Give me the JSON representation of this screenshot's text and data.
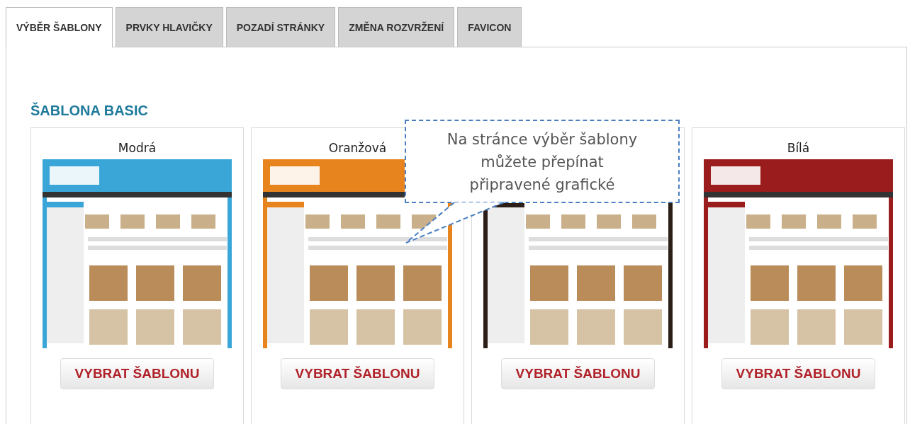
{
  "tabs": [
    {
      "label": "VÝBĚR ŠABLONY",
      "selected": true
    },
    {
      "label": "PRVKY HLAVIČKY",
      "selected": false
    },
    {
      "label": "POZADÍ STRÁNKY",
      "selected": false
    },
    {
      "label": "ZMĚNA ROZVRŽENÍ",
      "selected": false
    },
    {
      "label": "FAVICON",
      "selected": false
    }
  ],
  "section_title": "ŠABLONA BASIC",
  "templates": [
    {
      "name": "Modrá",
      "color": "#3aa6d8",
      "button": "VYBRAT ŠABLONU"
    },
    {
      "name": "Oranžová",
      "color": "#e8841e",
      "button": "VYBRAT ŠABLONU"
    },
    {
      "color": "#2a1e16",
      "button": "VYBRAT ŠABLONU"
    },
    {
      "name": "Bílá",
      "color": "#9b1c1c",
      "button": "VYBRAT ŠABLONU"
    }
  ],
  "callout": {
    "lines": [
      "Na stránce výběr šablony",
      "můžete přepínat",
      "připravené grafické"
    ]
  }
}
